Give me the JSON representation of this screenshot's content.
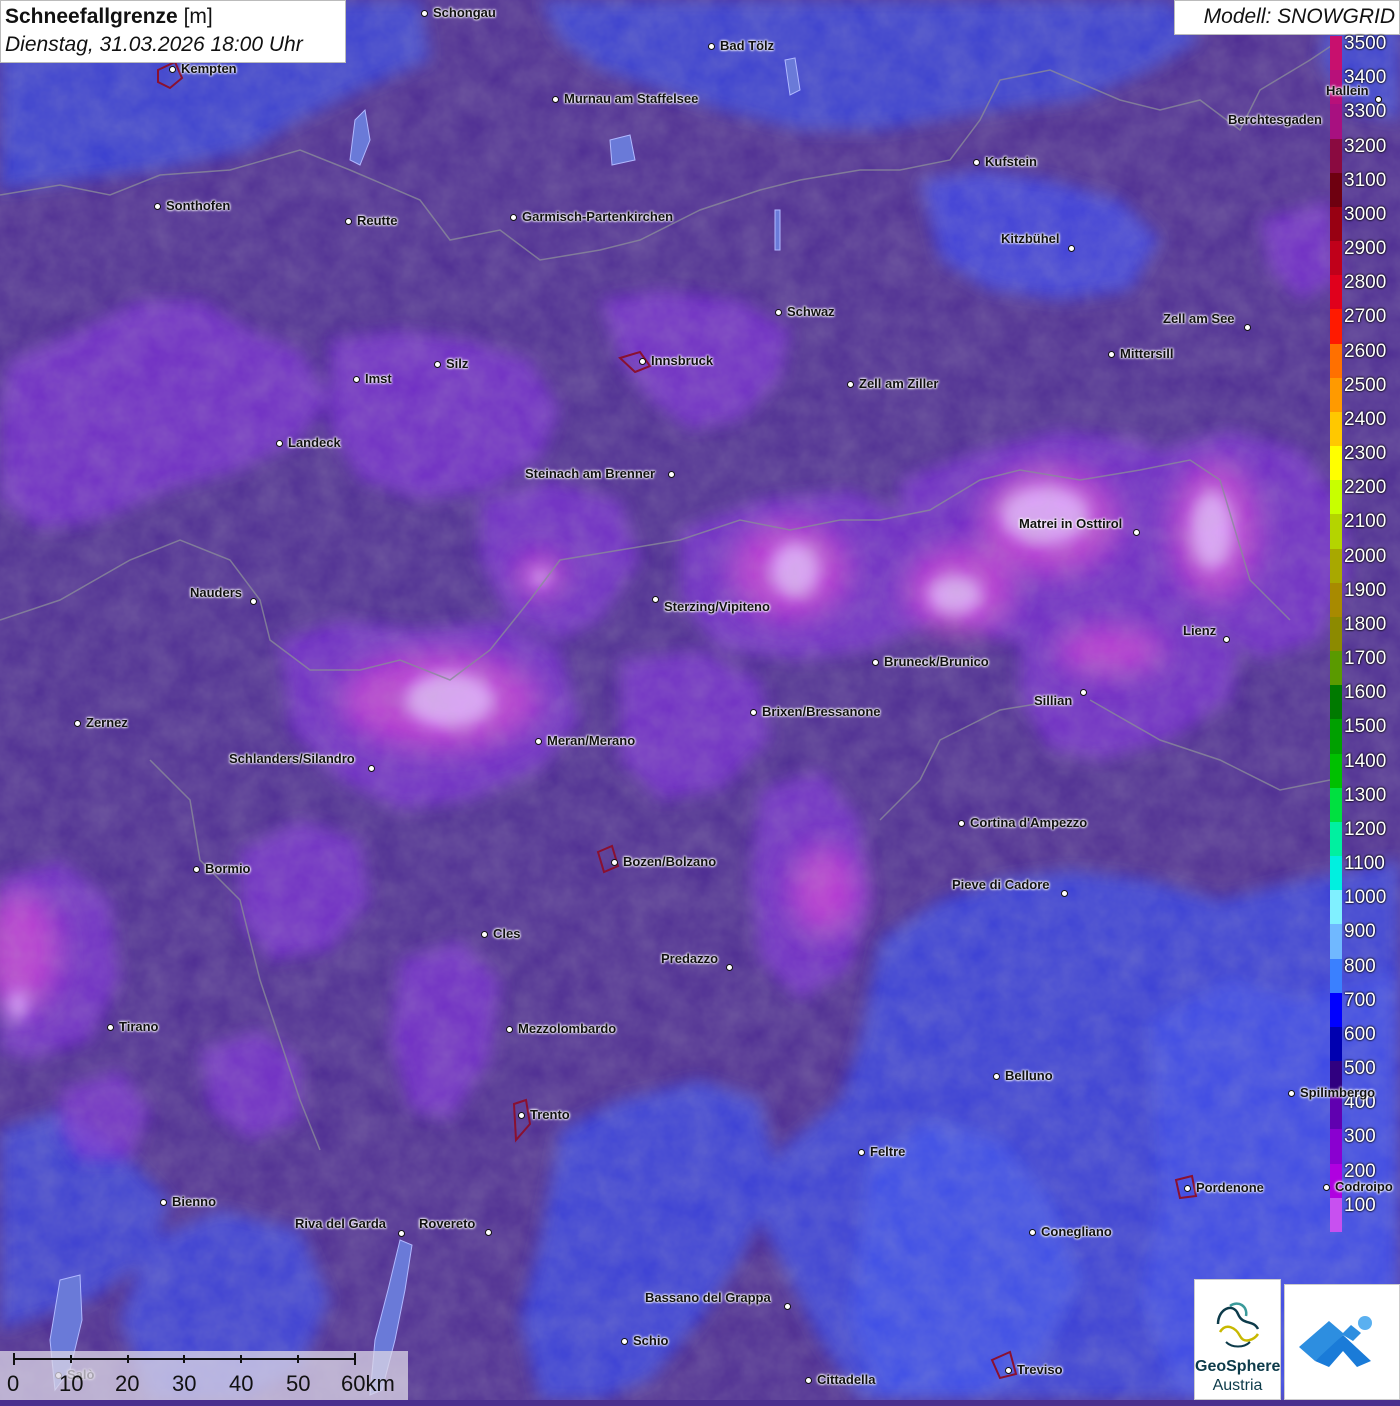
{
  "title": {
    "parameter": "Schneefallgrenze",
    "unit": "[m]",
    "datetime": "Dienstag, 31.03.2026 18:00 Uhr"
  },
  "model": "Modell: SNOWGRID",
  "legend": {
    "labels": [
      "3500",
      "3400",
      "3300",
      "3200",
      "3100",
      "3000",
      "2900",
      "2800",
      "2700",
      "2600",
      "2500",
      "2400",
      "2300",
      "2200",
      "2100",
      "2000",
      "1900",
      "1800",
      "1700",
      "1600",
      "1500",
      "1400",
      "1300",
      "1200",
      "1100",
      "1000",
      "900",
      "800",
      "700",
      "600",
      "500",
      "400",
      "300",
      "200",
      "100"
    ],
    "colors": [
      "#c8106e",
      "#b8107a",
      "#a81080",
      "#8a0a40",
      "#6e0010",
      "#980012",
      "#c0001a",
      "#e0001c",
      "#ff1a00",
      "#ff7000",
      "#ff9a00",
      "#ffc800",
      "#ffff00",
      "#c8ff00",
      "#b4d400",
      "#a8a800",
      "#a88a00",
      "#8c8a00",
      "#5a9a00",
      "#007a00",
      "#00a000",
      "#00c000",
      "#00e040",
      "#00f0a0",
      "#00f0e0",
      "#80f0ff",
      "#70b8ff",
      "#3a80ff",
      "#0000ff",
      "#0000b0",
      "#300080",
      "#6000b0",
      "#8a00d0",
      "#b000e0",
      "#c850f0"
    ]
  },
  "cities": [
    {
      "name": "Schongau",
      "label_side": "right"
    },
    {
      "name": "Bad Tölz",
      "label_side": "right"
    },
    {
      "name": "Kempten",
      "label_side": "right"
    },
    {
      "name": "Murnau am Staffelsee",
      "label_side": "right"
    },
    {
      "name": "Berchtesgaden",
      "label_side": "left"
    },
    {
      "name": "Hallein",
      "label_side": "left"
    },
    {
      "name": "Kufstein",
      "label_side": "right"
    },
    {
      "name": "Sonthofen",
      "label_side": "right"
    },
    {
      "name": "Reutte",
      "label_side": "right"
    },
    {
      "name": "Garmisch-Partenkirchen",
      "label_side": "right"
    },
    {
      "name": "Kitzbühel",
      "label_side": "left"
    },
    {
      "name": "Schwaz",
      "label_side": "right"
    },
    {
      "name": "Zell am See",
      "label_side": "left"
    },
    {
      "name": "Innsbruck",
      "label_side": "right"
    },
    {
      "name": "Mittersill",
      "label_side": "right"
    },
    {
      "name": "Imst",
      "label_side": "right"
    },
    {
      "name": "Silz",
      "label_side": "right"
    },
    {
      "name": "Zell am Ziller",
      "label_side": "right"
    },
    {
      "name": "Landeck",
      "label_side": "right"
    },
    {
      "name": "Steinach am Brenner",
      "label_side": "left"
    },
    {
      "name": "Matrei in Osttirol",
      "label_side": "left"
    },
    {
      "name": "Nauders",
      "label_side": "left"
    },
    {
      "name": "Sterzing/Vipiteno",
      "label_side": "right"
    },
    {
      "name": "Lienz",
      "label_side": "left"
    },
    {
      "name": "Bruneck/Brunico",
      "label_side": "right"
    },
    {
      "name": "Sillian",
      "label_side": "left"
    },
    {
      "name": "Zernez",
      "label_side": "right"
    },
    {
      "name": "Brixen/Bressanone",
      "label_side": "right"
    },
    {
      "name": "Meran/Merano",
      "label_side": "right"
    },
    {
      "name": "Schlanders/Silandro",
      "label_side": "left"
    },
    {
      "name": "Cortina d'Ampezzo",
      "label_side": "right"
    },
    {
      "name": "Bozen/Bolzano",
      "label_side": "right"
    },
    {
      "name": "Bormio",
      "label_side": "right"
    },
    {
      "name": "Pieve di Cadore",
      "label_side": "left"
    },
    {
      "name": "Cles",
      "label_side": "right"
    },
    {
      "name": "Predazzo",
      "label_side": "left"
    },
    {
      "name": "Tirano",
      "label_side": "right"
    },
    {
      "name": "Mezzolombardo",
      "label_side": "right"
    },
    {
      "name": "Belluno",
      "label_side": "right"
    },
    {
      "name": "Spilimbergo",
      "label_side": "right"
    },
    {
      "name": "Trento",
      "label_side": "right"
    },
    {
      "name": "Feltre",
      "label_side": "right"
    },
    {
      "name": "Pordenone",
      "label_side": "right"
    },
    {
      "name": "Codroipo",
      "label_side": "right"
    },
    {
      "name": "Bienno",
      "label_side": "right"
    },
    {
      "name": "Riva del Garda",
      "label_side": "left"
    },
    {
      "name": "Rovereto",
      "label_side": "left"
    },
    {
      "name": "Conegliano",
      "label_side": "right"
    },
    {
      "name": "Bassano del Grappa",
      "label_side": "left"
    },
    {
      "name": "Schio",
      "label_side": "right"
    },
    {
      "name": "Treviso",
      "label_side": "right"
    },
    {
      "name": "Cittadella",
      "label_side": "right"
    },
    {
      "name": "Salò",
      "label_side": "right"
    }
  ],
  "scale": {
    "labels": [
      "0",
      "10",
      "20",
      "30",
      "40",
      "50",
      "60km"
    ]
  },
  "logos": {
    "geosphere_line1": "GeoSphere",
    "geosphere_line2": "Austria"
  }
}
